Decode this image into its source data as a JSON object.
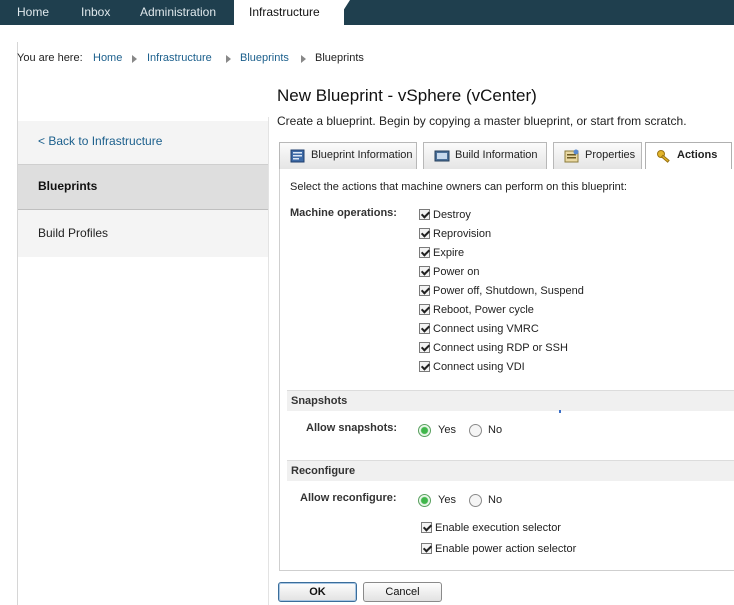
{
  "topnav": {
    "tabs": [
      "Home",
      "Inbox",
      "Administration",
      "Infrastructure"
    ]
  },
  "breadcrumb": {
    "prefix": "You are here:",
    "items": [
      "Home",
      "Infrastructure",
      "Blueprints",
      "Blueprints"
    ]
  },
  "sidebar": {
    "back_label": "< Back to Infrastructure",
    "items": [
      {
        "label": "Blueprints",
        "selected": true
      },
      {
        "label": "Build Profiles",
        "selected": false
      }
    ]
  },
  "page": {
    "title": "New Blueprint - vSphere (vCenter)",
    "subtitle": "Create a blueprint. Begin by copying a master blueprint, or start from scratch."
  },
  "tabs": [
    {
      "label": "Blueprint Information",
      "icon": "blueprint-info-icon",
      "active": false
    },
    {
      "label": "Build Information",
      "icon": "build-info-icon",
      "active": false
    },
    {
      "label": "Properties",
      "icon": "properties-icon",
      "active": false
    },
    {
      "label": "Actions",
      "icon": "key-icon",
      "active": true
    }
  ],
  "actions": {
    "intro": "Select the actions that machine owners can perform on this blueprint:",
    "machine_ops_label": "Machine operations:",
    "machine_ops": [
      {
        "label": "Destroy",
        "checked": true
      },
      {
        "label": "Reprovision",
        "checked": true
      },
      {
        "label": "Expire",
        "checked": true
      },
      {
        "label": "Power on",
        "checked": true
      },
      {
        "label": "Power off, Shutdown, Suspend",
        "checked": true
      },
      {
        "label": "Reboot, Power cycle",
        "checked": true
      },
      {
        "label": "Connect using VMRC",
        "checked": true
      },
      {
        "label": "Connect using RDP or SSH",
        "checked": true
      },
      {
        "label": "Connect using VDI",
        "checked": true
      }
    ],
    "snapshots": {
      "heading": "Snapshots",
      "label": "Allow snapshots:",
      "yes": "Yes",
      "no": "No",
      "selected": "Yes"
    },
    "reconfigure": {
      "heading": "Reconfigure",
      "label": "Allow reconfigure:",
      "yes": "Yes",
      "no": "No",
      "selected": "Yes",
      "options": [
        {
          "label": "Enable execution selector",
          "checked": true
        },
        {
          "label": "Enable power action selector",
          "checked": true
        }
      ]
    }
  },
  "footer": {
    "ok_label": "OK",
    "cancel_label": "Cancel"
  },
  "colors": {
    "topnav_bg": "#1f3f4e",
    "link": "#1b5f8c",
    "radio_on": "#3fb64a"
  }
}
